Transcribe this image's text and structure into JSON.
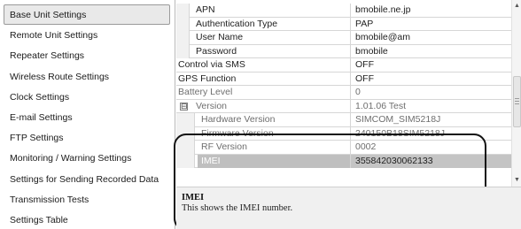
{
  "nav": {
    "items": [
      {
        "label": "Base Unit Settings",
        "selected": true
      },
      {
        "label": "Remote Unit Settings"
      },
      {
        "label": "Repeater Settings"
      },
      {
        "label": "Wireless Route Settings"
      },
      {
        "label": "Clock Settings"
      },
      {
        "label": "E-mail Settings"
      },
      {
        "label": "FTP Settings"
      },
      {
        "label": "Monitoring / Warning Settings"
      },
      {
        "label": "Settings for Sending Recorded Data"
      },
      {
        "label": "Transmission Tests"
      },
      {
        "label": "Settings Table"
      }
    ]
  },
  "grid": {
    "rows": [
      {
        "name": "APN",
        "value": "bmobile.ne.jp"
      },
      {
        "name": "Authentication Type",
        "value": "PAP"
      },
      {
        "name": "User Name",
        "value": "bmobile@am"
      },
      {
        "name": "Password",
        "value": "bmobile"
      },
      {
        "name": "Control via SMS",
        "value": "OFF"
      },
      {
        "name": "GPS Function",
        "value": "OFF"
      },
      {
        "name": "Battery Level",
        "value": "0"
      },
      {
        "name": "Version",
        "value": "1.01.06 Test",
        "expander": "⊟"
      },
      {
        "name": "Hardware Version",
        "value": "SIMCOM_SIM5218J"
      },
      {
        "name": "Firmware Version",
        "value": "240150B18SIM5218J"
      },
      {
        "name": "RF Version",
        "value": "0002"
      },
      {
        "name": "IMEI",
        "value": "355842030062133"
      }
    ]
  },
  "description": {
    "title": "IMEI",
    "text": "This shows the IMEI number."
  },
  "scrollbar": {
    "up_glyph": "▲",
    "down_glyph": "▼"
  },
  "colors": {
    "selected_row": "#c4c4c4",
    "highlight_border": "#111111",
    "desc_background": "#f0f0f0"
  }
}
